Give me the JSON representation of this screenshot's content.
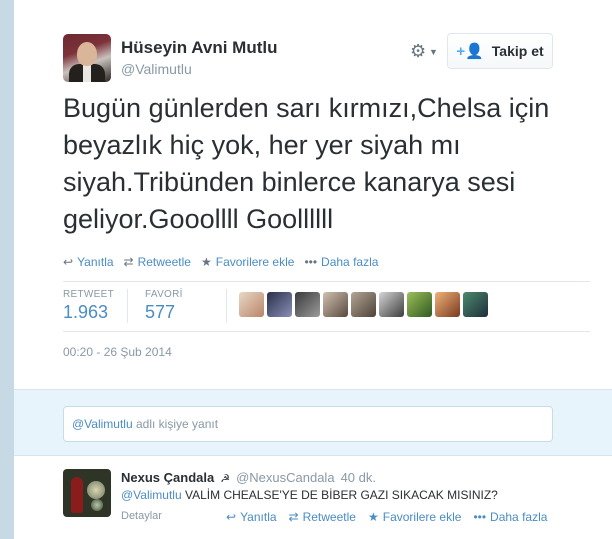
{
  "tweet": {
    "author_name": "Hüseyin Avni Mutlu",
    "author_handle": "@Valimutlu",
    "follow_label": "Takip et",
    "text": "Bugün günlerden sarı kırmızı,Chelsa için beyazlık hiç yok, her yer siyah mı siyah.Tribünden binlerce kanarya sesi geliyor.Gooollll Goollllll",
    "actions": {
      "reply": "Yanıtla",
      "retweet": "Retweetle",
      "favorite": "Favorilere ekle",
      "more": "Daha fazla"
    },
    "stats": {
      "retweet_label": "RETWEET",
      "retweet_count": "1.963",
      "favorite_label": "FAVORİ",
      "favorite_count": "577"
    },
    "favoriters_count": 9,
    "timestamp": "00:20 - 26 Şub 2014"
  },
  "reply_box": {
    "mention": "@Valimutlu",
    "placeholder": "adlı kişiye yanıt"
  },
  "reply": {
    "author_name": "Nexus Çandala",
    "badge": "☭",
    "author_handle": "@NexusCandala",
    "time": "40 dk.",
    "mention": "@Valimutlu",
    "text": "VALİM CHEALSE'YE DE BİBER GAZI SIKACAK MISINIZ?",
    "details": "Detaylar",
    "actions": {
      "reply": "Yanıtla",
      "retweet": "Retweetle",
      "favorite": "Favorilere ekle",
      "more": "Daha fazla"
    }
  },
  "colors": {
    "link": "#4a8cc4",
    "muted": "#8899a6",
    "reply_bg": "#e8f4fb"
  }
}
